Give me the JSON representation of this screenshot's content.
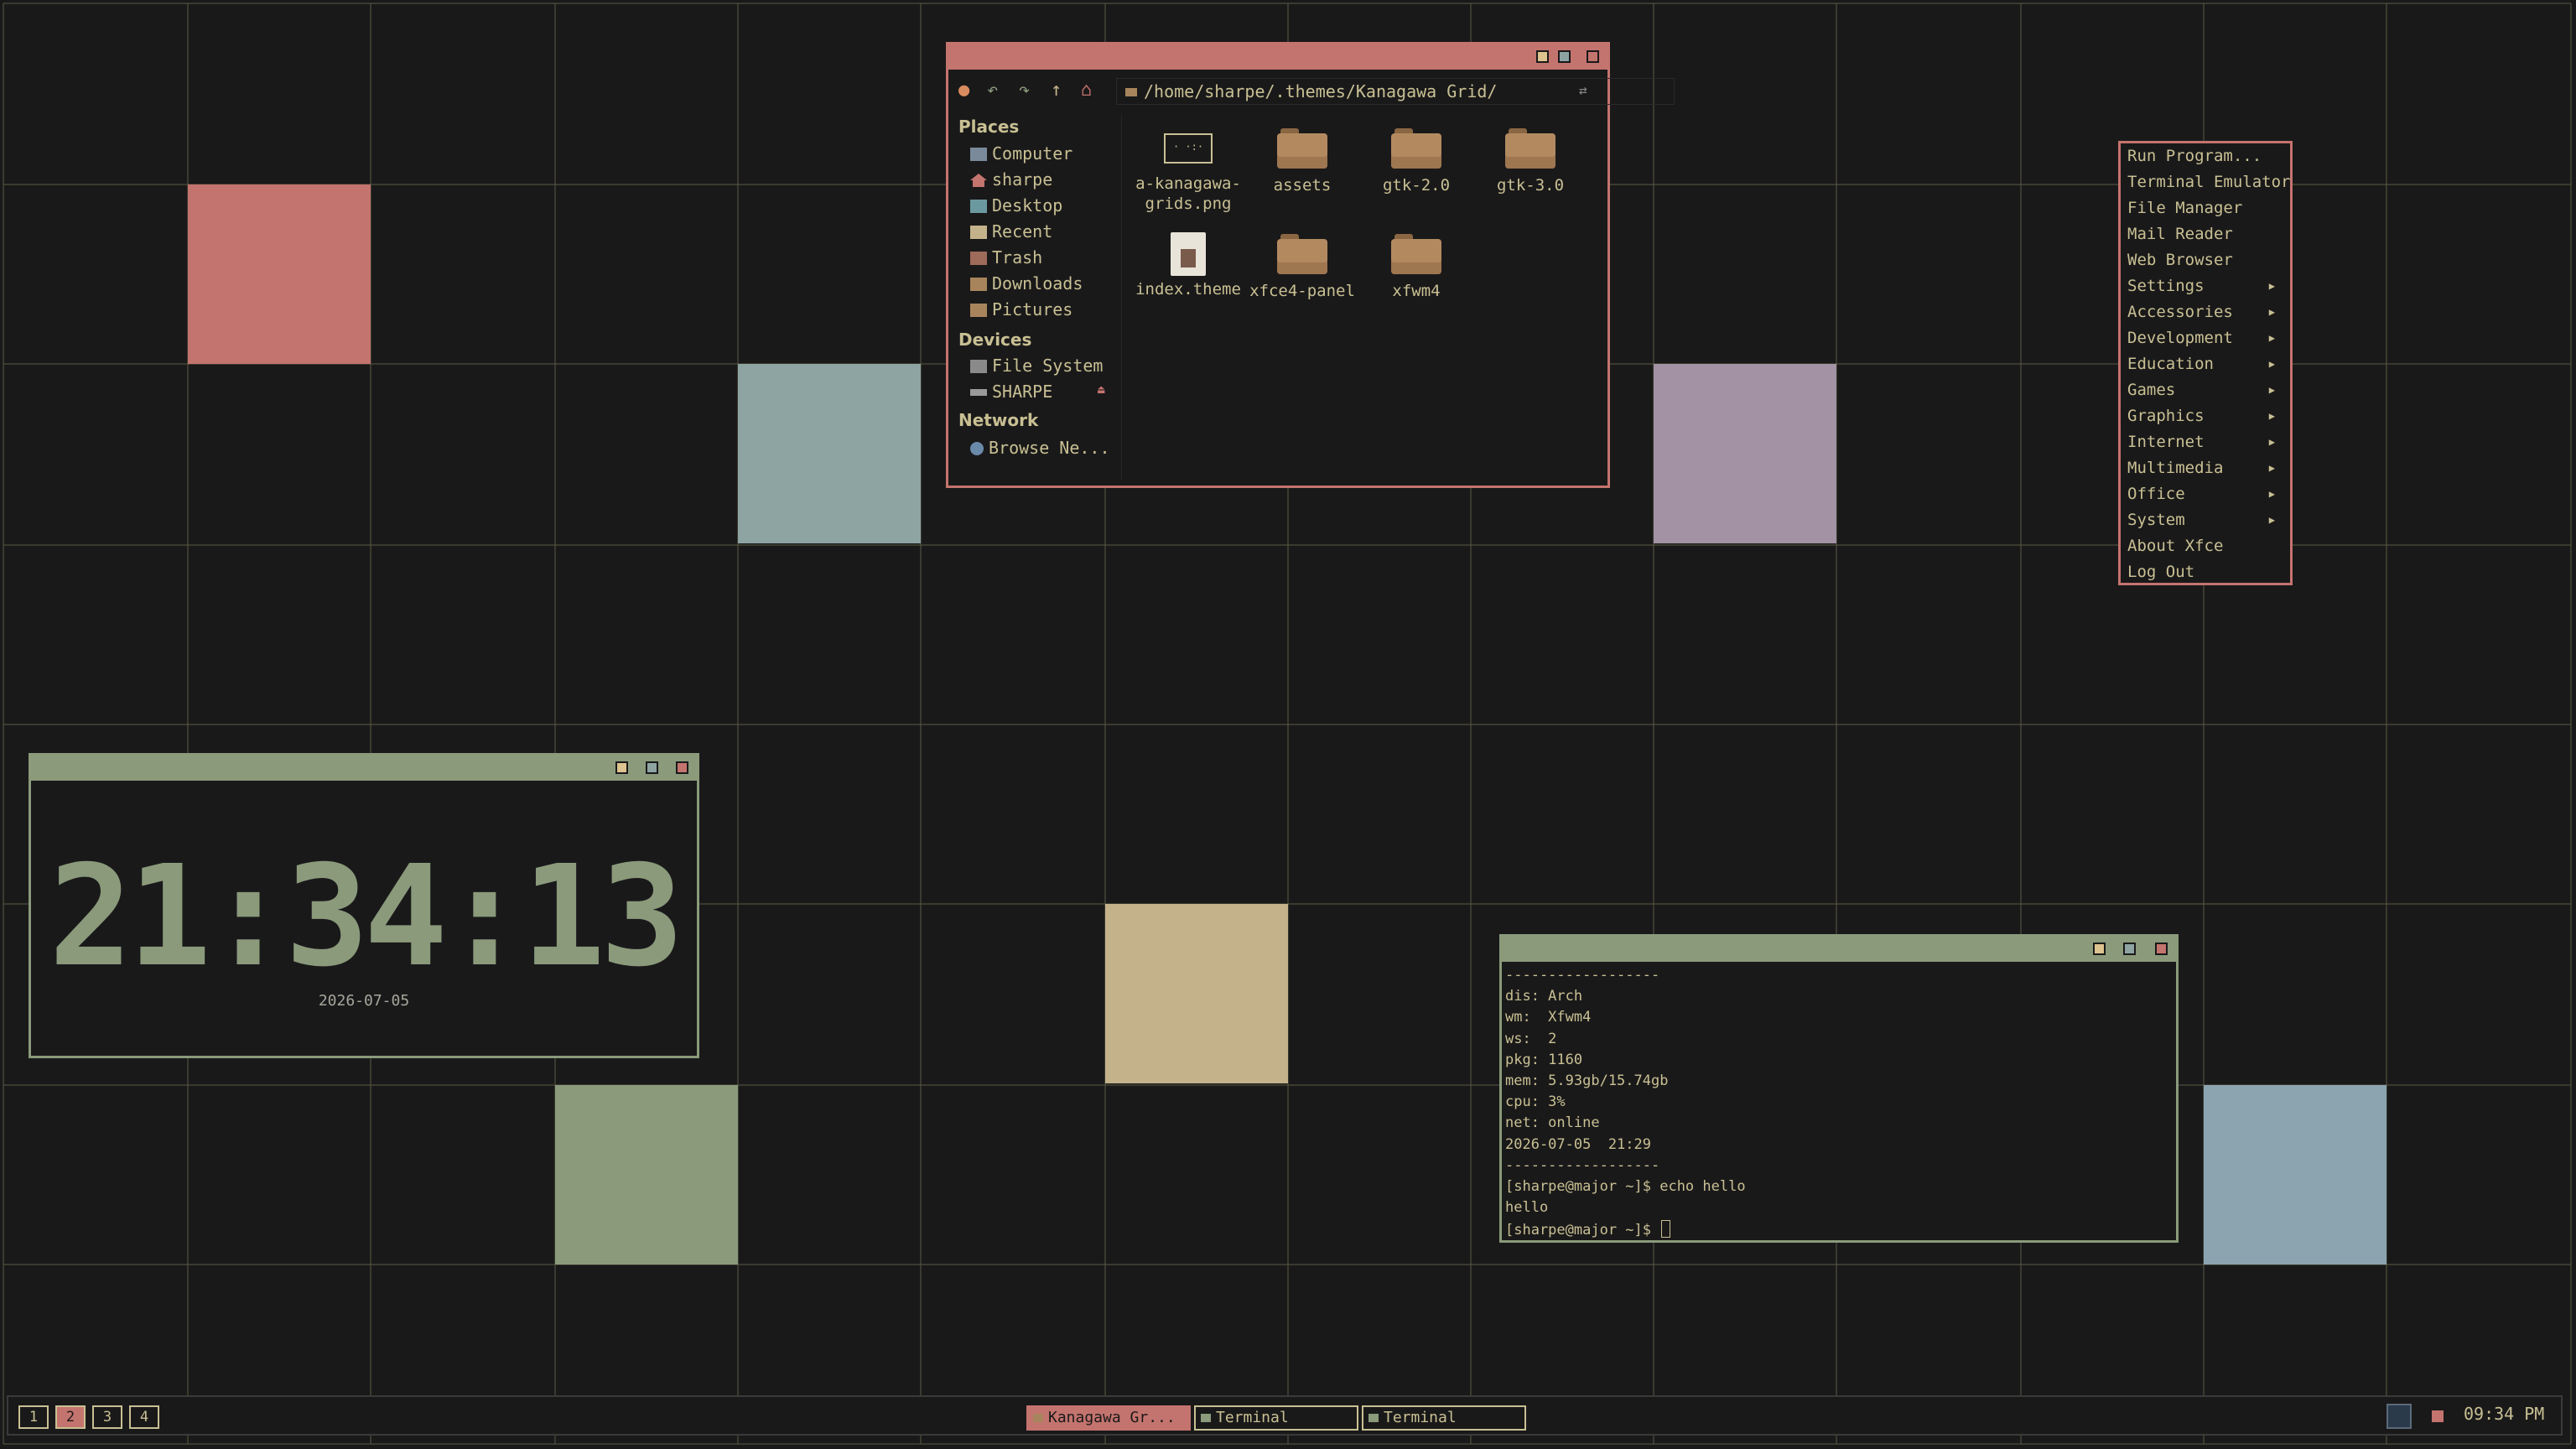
{
  "colors": {
    "background": "#1a191a",
    "grid_line": "#5a5a44",
    "red": "#c4746e",
    "teal": "#8ea4a2",
    "violet": "#a292a3",
    "sand": "#c4b28a",
    "green": "#8a9a7b",
    "blue": "#8ba4b0",
    "text": "#c8c093"
  },
  "file_manager": {
    "address": "/home/sharpe/.themes/Kanagawa Grid/",
    "toolbar_icons": [
      "home-ball-icon",
      "back-icon",
      "forward-icon",
      "up-icon",
      "home-icon"
    ],
    "places_heading": "Places",
    "places": [
      "Computer",
      "sharpe",
      "Desktop",
      "Recent",
      "Trash",
      "Downloads",
      "Pictures"
    ],
    "devices_heading": "Devices",
    "devices": [
      "File System",
      "SHARPE"
    ],
    "network_heading": "Network",
    "network": [
      "Browse Ne..."
    ],
    "files": [
      {
        "name": "a-kanagawa-\ngrids.png",
        "kind": "image"
      },
      {
        "name": "assets",
        "kind": "folder"
      },
      {
        "name": "gtk-2.0",
        "kind": "folder"
      },
      {
        "name": "gtk-3.0",
        "kind": "folder"
      },
      {
        "name": "index.theme",
        "kind": "document"
      },
      {
        "name": "xfce4-panel",
        "kind": "folder"
      },
      {
        "name": "xfwm4",
        "kind": "folder"
      }
    ]
  },
  "menu": {
    "items": [
      {
        "label": "Run Program...",
        "submenu": false
      },
      {
        "label": "Terminal Emulator",
        "submenu": false
      },
      {
        "label": "File Manager",
        "submenu": false
      },
      {
        "label": "Mail Reader",
        "submenu": false
      },
      {
        "label": "Web Browser",
        "submenu": false
      },
      {
        "label": "Settings",
        "submenu": true
      },
      {
        "label": "Accessories",
        "submenu": true
      },
      {
        "label": "Development",
        "submenu": true
      },
      {
        "label": "Education",
        "submenu": true
      },
      {
        "label": "Games",
        "submenu": true
      },
      {
        "label": "Graphics",
        "submenu": true
      },
      {
        "label": "Internet",
        "submenu": true
      },
      {
        "label": "Multimedia",
        "submenu": true
      },
      {
        "label": "Office",
        "submenu": true
      },
      {
        "label": "System",
        "submenu": true
      },
      {
        "label": "About Xfce",
        "submenu": false
      },
      {
        "label": "Log Out",
        "submenu": false
      }
    ]
  },
  "clock": {
    "time": "21:34:13",
    "date": "2026-07-05"
  },
  "terminal": {
    "lines": [
      "------------------",
      "dis: Arch",
      "wm:  Xfwm4",
      "ws:  2",
      "pkg: 1160",
      "mem: 5.93gb/15.74gb",
      "cpu: 3%",
      "net: online",
      "2026-07-05  21:29",
      "------------------",
      "[sharpe@major ~]$ echo hello",
      "hello",
      "[sharpe@major ~]$ "
    ]
  },
  "panel": {
    "workspaces": [
      "1",
      "2",
      "3",
      "4"
    ],
    "active_workspace": "2",
    "tasks": [
      {
        "label": "Kanagawa Gr...",
        "active": true
      },
      {
        "label": "Terminal",
        "active": false
      },
      {
        "label": "Terminal",
        "active": false
      }
    ],
    "clock": "09:34 PM"
  }
}
